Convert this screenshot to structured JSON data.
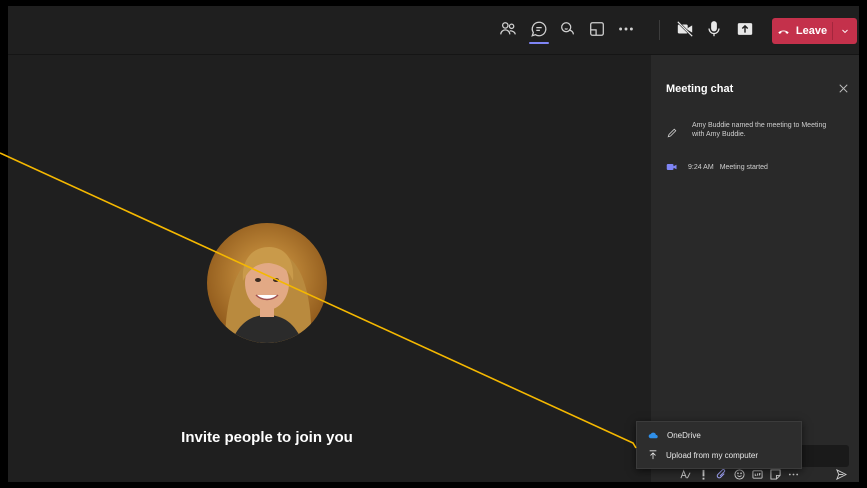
{
  "toolbar": {
    "icons": [
      "people-icon",
      "chat-icon",
      "reactions-icon",
      "share-tray-icon",
      "more-icon",
      "camera-off-icon",
      "mic-icon",
      "share-screen-icon"
    ],
    "leave_label": "Leave"
  },
  "stage": {
    "invite_text": "Invite people to join you"
  },
  "chat": {
    "title": "Meeting chat",
    "message_rename": "Amy Buddie named the meeting to Meeting with Amy Buddie.",
    "message_started_time": "9:24 AM",
    "message_started_text": "Meeting started"
  },
  "attach_menu": {
    "onedrive": "OneDrive",
    "upload": "Upload from my computer"
  },
  "colors": {
    "accent": "#7f85f5",
    "leave": "#c4314b",
    "annotation_line": "#f5b800"
  }
}
